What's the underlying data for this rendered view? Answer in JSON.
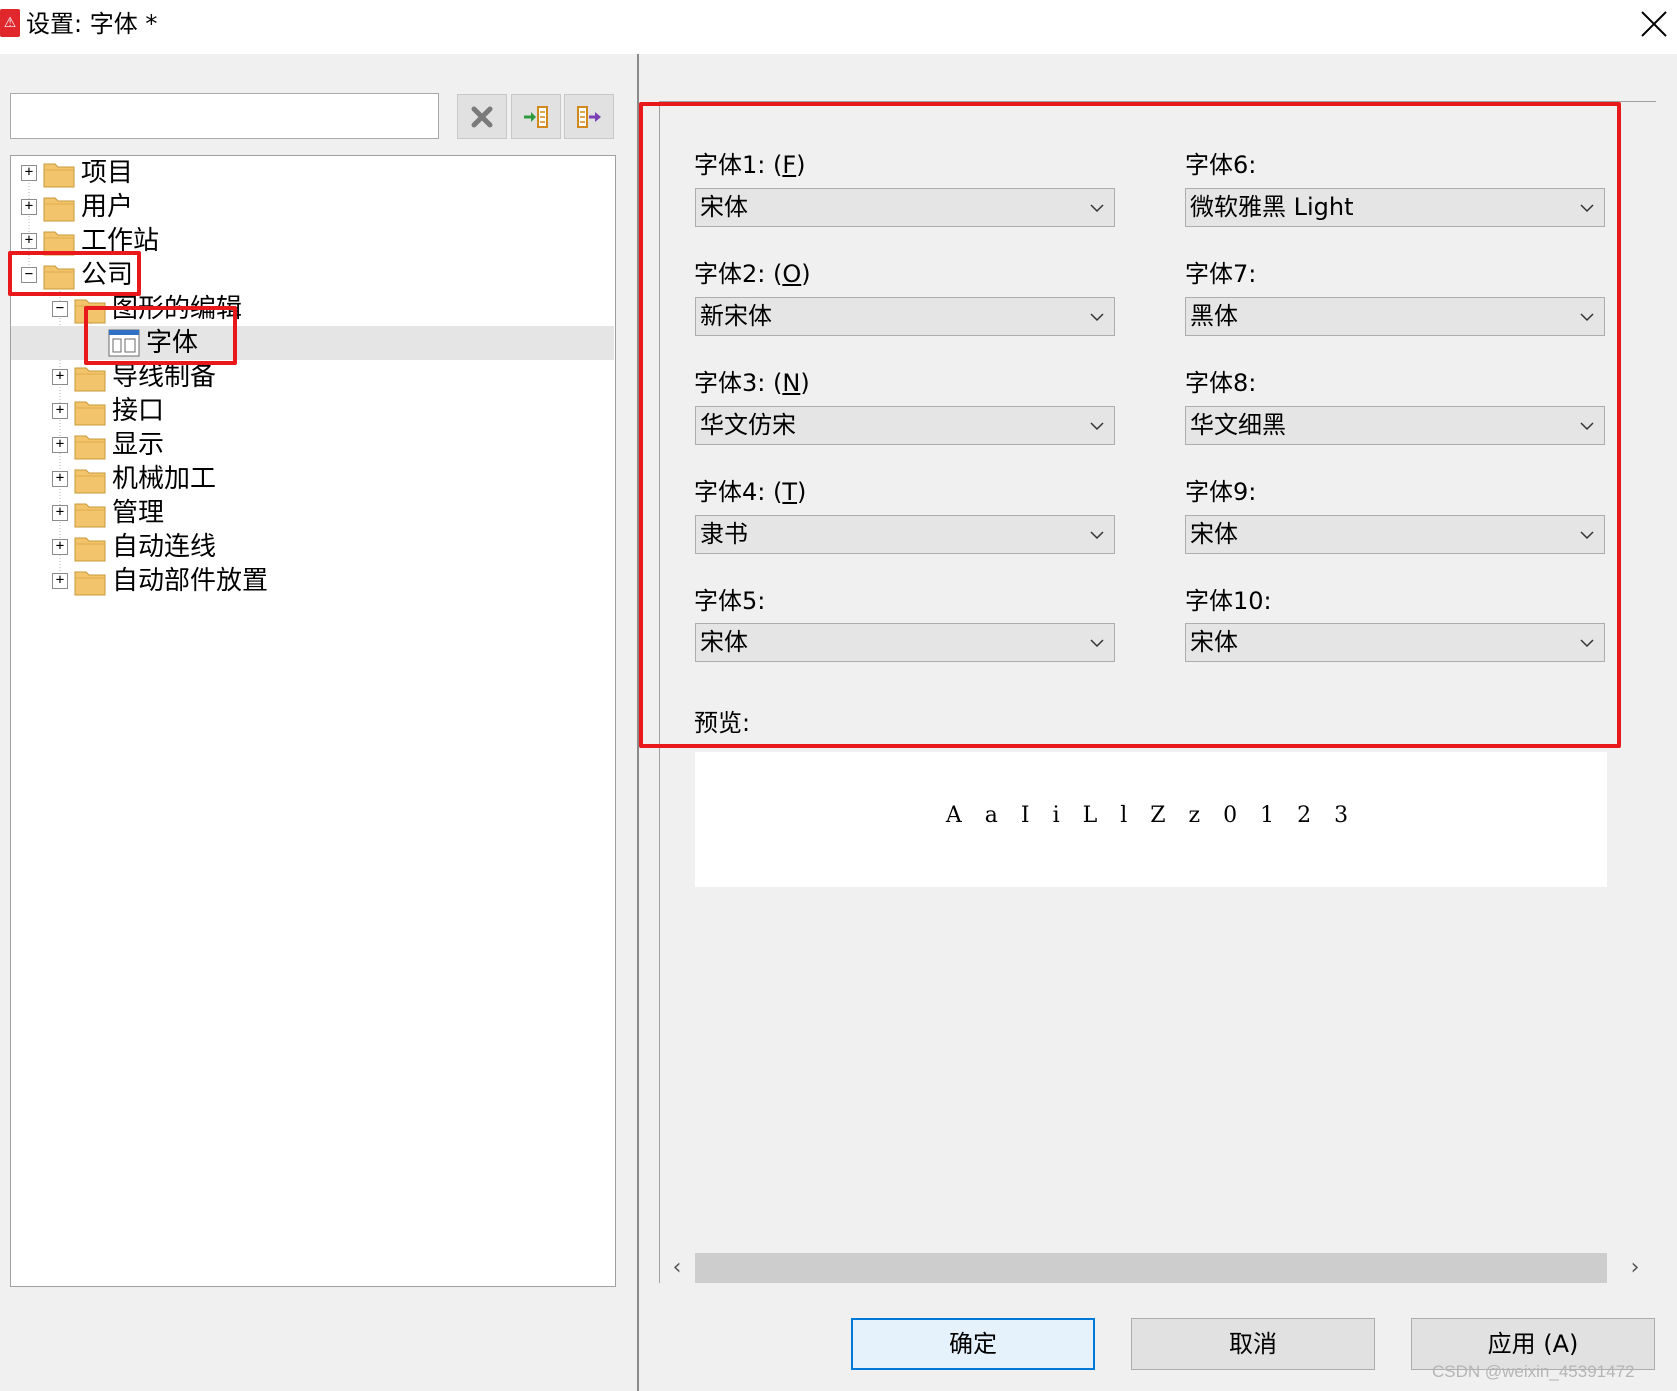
{
  "window": {
    "title": "设置: 字体 *",
    "app_icon_glyph": "⚠",
    "close_glyph": "✕"
  },
  "search": {
    "value": "",
    "placeholder": ""
  },
  "toolbar": {
    "clear_icon": "clear-icon",
    "expand_icon": "expand-icon",
    "collapse_icon": "collapse-icon"
  },
  "tree": {
    "items": [
      {
        "label": "项目",
        "expander": "+"
      },
      {
        "label": "用户",
        "expander": "+"
      },
      {
        "label": "工作站",
        "expander": "+"
      },
      {
        "label": "公司",
        "expander": "−"
      },
      {
        "label": "图形的编辑",
        "expander": "−"
      },
      {
        "label": "字体",
        "expander": ""
      },
      {
        "label": "导线制备",
        "expander": "+"
      },
      {
        "label": "接口",
        "expander": "+"
      },
      {
        "label": "显示",
        "expander": "+"
      },
      {
        "label": "机械加工",
        "expander": "+"
      },
      {
        "label": "管理",
        "expander": "+"
      },
      {
        "label": "自动连线",
        "expander": "+"
      },
      {
        "label": "自动部件放置",
        "expander": "+"
      }
    ]
  },
  "fonts": {
    "left": [
      {
        "label": "字体1: (",
        "key": "F",
        "suffix": ")",
        "value": "宋体"
      },
      {
        "label": "字体2: (",
        "key": "O",
        "suffix": ")",
        "value": "新宋体"
      },
      {
        "label": "字体3: (",
        "key": "N",
        "suffix": ")",
        "value": "华文仿宋"
      },
      {
        "label": "字体4: (",
        "key": "T",
        "suffix": ")",
        "value": "隶书"
      },
      {
        "label": "字体5:",
        "key": "",
        "suffix": "",
        "value": "宋体"
      }
    ],
    "right": [
      {
        "label": "字体6:",
        "value": "微软雅黑 Light"
      },
      {
        "label": "字体7:",
        "value": "黑体"
      },
      {
        "label": "字体8:",
        "value": "华文细黑"
      },
      {
        "label": "字体9:",
        "value": "宋体"
      },
      {
        "label": "字体10:",
        "value": "宋体"
      }
    ]
  },
  "preview": {
    "label": "预览:",
    "sample": "A a I i L l Z z 0 1 2 3"
  },
  "scrollbar": {
    "left_arrow": "‹",
    "right_arrow": "›"
  },
  "buttons": {
    "ok": "确定",
    "cancel": "取消",
    "apply": "应用 (A)"
  },
  "watermark": "CSDN @weixin_45391472",
  "colors": {
    "highlight_box": "#e8181b",
    "folder": "#f2c46c",
    "default_button_border": "#0078d7"
  }
}
